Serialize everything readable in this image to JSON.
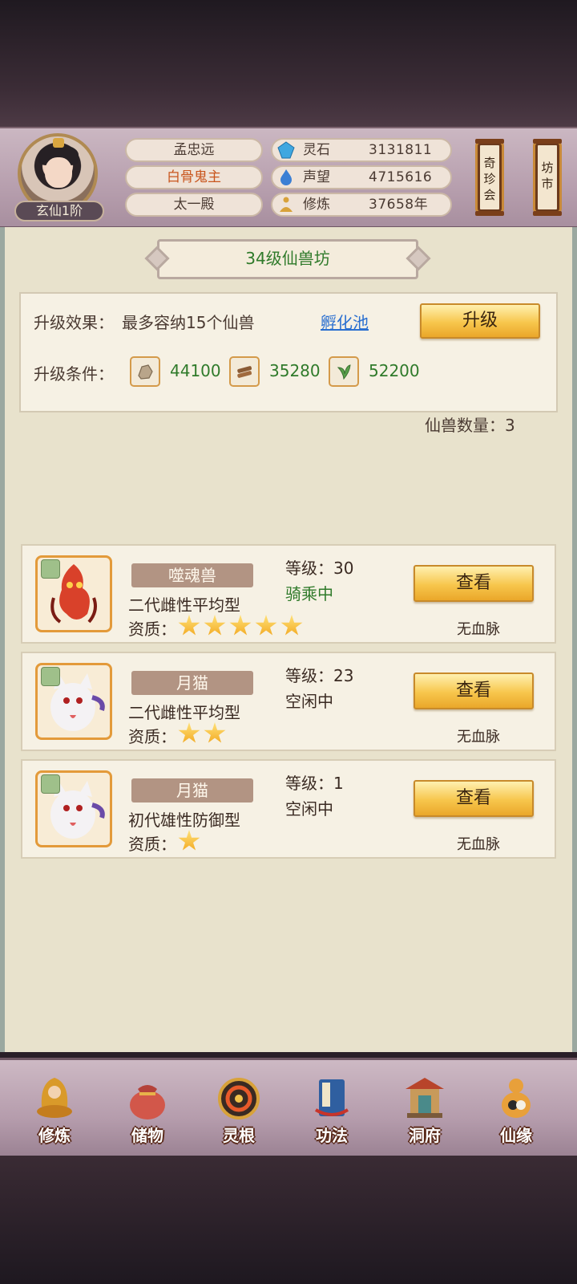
{
  "player": {
    "rank": "玄仙1阶",
    "name": "孟忠远",
    "title": "白骨鬼主",
    "sect": "太一殿"
  },
  "resources": [
    {
      "label": "灵石",
      "value": "3131811",
      "icon": "spirit-stone-icon",
      "color": "#3fa7e0"
    },
    {
      "label": "声望",
      "value": "4715616",
      "icon": "prestige-flame-icon",
      "color": "#3b7fd4"
    },
    {
      "label": "修炼",
      "value": "37658年",
      "icon": "meditation-icon",
      "color": "#d8a23a"
    }
  ],
  "side_buttons": {
    "treasure": "奇珍会",
    "market": "坊市"
  },
  "workshop": {
    "title": "34级仙兽坊",
    "effect_label": "升级效果：",
    "effect_value": "最多容纳15个仙兽",
    "hatch_link": "孵化池",
    "upgrade_button": "升级",
    "condition_label": "升级条件：",
    "materials": [
      {
        "icon": "ore-icon",
        "amount": "44100"
      },
      {
        "icon": "wood-icon",
        "amount": "35280"
      },
      {
        "icon": "herb-icon",
        "amount": "52200"
      }
    ],
    "pet_count": "仙兽数量：3"
  },
  "pets": [
    {
      "name": "噬魂兽",
      "desc": "二代雌性平均型",
      "level": "等级：30",
      "status": "骑乘中",
      "quality_label": "资质：",
      "stars": 5,
      "view": "查看",
      "bloodline": "无血脉",
      "status_color": "green"
    },
    {
      "name": "月猫",
      "desc": "二代雌性平均型",
      "level": "等级：23",
      "status": "空闲中",
      "quality_label": "资质：",
      "stars": 2,
      "view": "查看",
      "bloodline": "无血脉",
      "status_color": "normal"
    },
    {
      "name": "月猫",
      "desc": "初代雄性防御型",
      "level": "等级：1",
      "status": "空闲中",
      "quality_label": "资质：",
      "stars": 1,
      "view": "查看",
      "bloodline": "无血脉",
      "status_color": "normal"
    }
  ],
  "nav": [
    {
      "label": "修炼",
      "icon": "cultivation-icon"
    },
    {
      "label": "储物",
      "icon": "storage-bag-icon"
    },
    {
      "label": "灵根",
      "icon": "spirit-root-icon"
    },
    {
      "label": "功法",
      "icon": "technique-book-icon"
    },
    {
      "label": "洞府",
      "icon": "cave-mansion-icon"
    },
    {
      "label": "仙缘",
      "icon": "immortal-fate-icon"
    }
  ]
}
